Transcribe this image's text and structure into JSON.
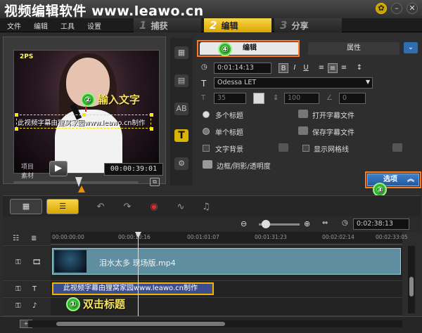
{
  "banner": {
    "title": "视频编辑软件 www.leawo.cn"
  },
  "menu": {
    "file": "文件",
    "edit": "编辑",
    "tools": "工具",
    "settings": "设置"
  },
  "steps": [
    {
      "num": "1",
      "label": "捕获"
    },
    {
      "num": "2",
      "label": "编辑"
    },
    {
      "num": "3",
      "label": "分享"
    }
  ],
  "preview": {
    "caption": "此视频字幕由狸窝家园www.leawo.cn制作",
    "stage_text": "2PS",
    "mode_project": "项目",
    "mode_clip": "素材",
    "timecode": "00:00:39:01"
  },
  "annotations": {
    "a1": {
      "num": "①",
      "text": "双击标题"
    },
    "a2": {
      "num": "②",
      "text": "输入文字"
    },
    "a3": {
      "num": "③"
    },
    "a4": {
      "num": "④"
    }
  },
  "options": {
    "tab_edit": "编辑",
    "tab_properties": "属性",
    "duration": "0:01:14:13",
    "bold": "B",
    "italic": "I",
    "underline": "U",
    "font": "Odessa LET",
    "font_size": "35",
    "line_spacing": "100",
    "angle": "0",
    "multi_title": "多个标题",
    "single_title": "单个标题",
    "text_bg": "文字背景",
    "open_subtitle": "打开字幕文件",
    "save_subtitle": "保存字幕文件",
    "show_grid": "显示网格线",
    "border_shadow": "边框/阴影/透明度",
    "options_button": "选项"
  },
  "timeline": {
    "zoom_timecode": "0:02:38:13",
    "ruler": [
      "00:00:00:00",
      "00:00:10:16",
      "00:01:01:07",
      "00:01:31:23",
      "00:02:02:14",
      "00:02:33:05"
    ],
    "video_clip_name": "泪水太多 现场版.mp4",
    "title_clip_text": "此视频字幕由狸窝家园www.leawo.cn制作"
  }
}
